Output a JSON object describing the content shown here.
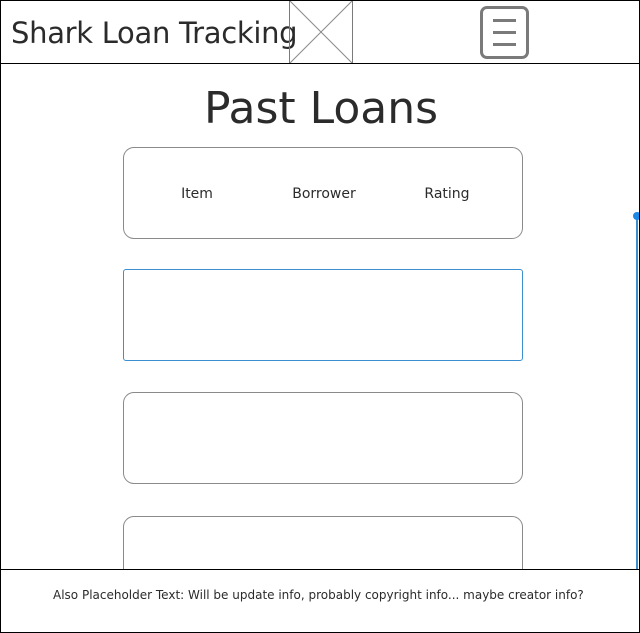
{
  "header": {
    "title": "Shark Loan Tracking",
    "logo_icon": "image-placeholder-icon",
    "menu_icon": "hamburger-menu-icon"
  },
  "main": {
    "page_title": "Past Loans",
    "columns": [
      "Item",
      "Borrower",
      "Rating"
    ],
    "rows": [
      {
        "item": "",
        "borrower": "",
        "rating": ""
      },
      {
        "item": "",
        "borrower": "",
        "rating": ""
      },
      {
        "item": "",
        "borrower": "",
        "rating": ""
      }
    ]
  },
  "footer": {
    "text": "Also Placeholder Text: Will be update info, probably copyright info... maybe creator info?"
  },
  "colors": {
    "accent": "#1e88e5",
    "selection_border": "#3b8fd0",
    "border": "#8a8a8a",
    "text": "#2b2b2b"
  }
}
